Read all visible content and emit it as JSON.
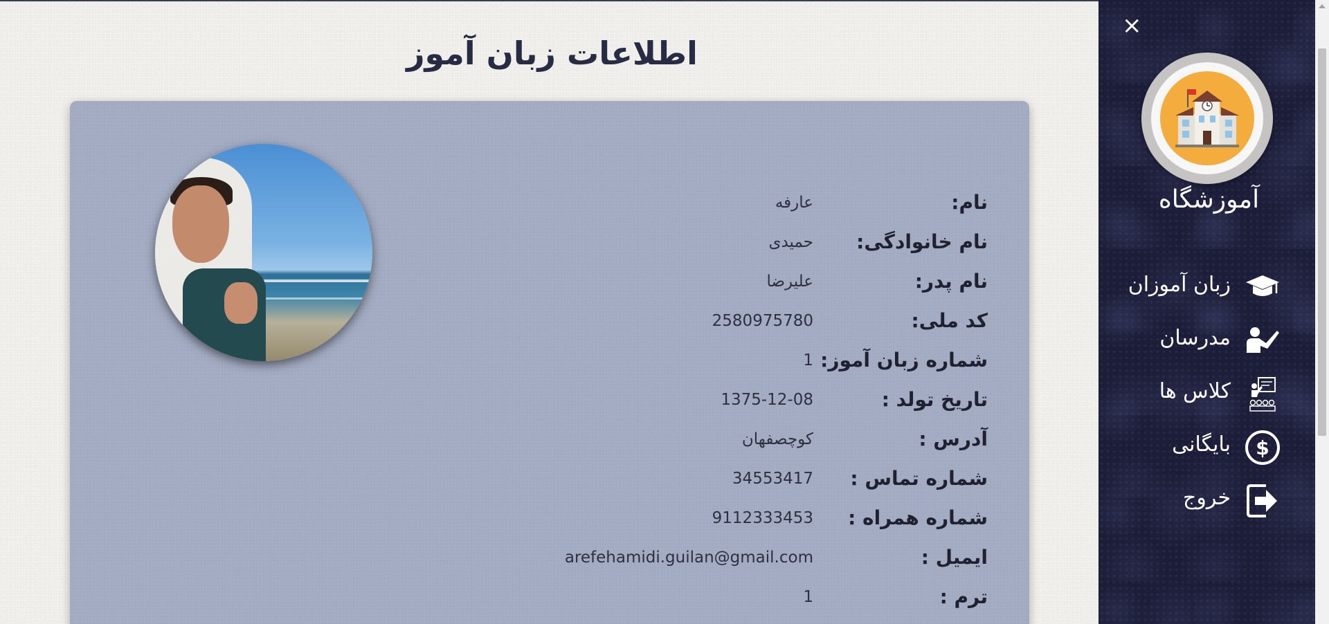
{
  "page": {
    "title": "اطلاعات زبان آموز"
  },
  "student": {
    "fields": [
      {
        "label": "نام:",
        "value": "عارفه"
      },
      {
        "label": "نام خانوادگی:",
        "value": "حمیدی"
      },
      {
        "label": "نام پدر:",
        "value": "علیرضا"
      },
      {
        "label": "کد ملی:",
        "value": "2580975780"
      },
      {
        "label": "شماره زبان آموز:",
        "value": "1"
      },
      {
        "label": "تاریخ تولد :",
        "value": "1375-12-08"
      },
      {
        "label": "آدرس :",
        "value": "کوچصفهان"
      },
      {
        "label": "شماره تماس :",
        "value": "34553417"
      },
      {
        "label": "شماره همراه :",
        "value": "9112333453"
      },
      {
        "label": "ایمیل :",
        "value": "arefehamidi.guilan@gmail.com"
      },
      {
        "label": "ترم :",
        "value": "1"
      }
    ]
  },
  "sidebar": {
    "close_icon": "×",
    "brand": "آموزشگاه",
    "items": [
      {
        "label": "زبان آموزان",
        "icon": "graduation-cap-icon"
      },
      {
        "label": "مدرسان",
        "icon": "teacher-icon"
      },
      {
        "label": "کلاس ها",
        "icon": "classroom-icon"
      },
      {
        "label": "بایگانی",
        "icon": "dollar-circle-icon"
      },
      {
        "label": "خروج",
        "icon": "sign-out-icon"
      }
    ]
  },
  "colors": {
    "sidebar_bg": "#1c1d38",
    "card_bg": "#a4adc4",
    "logo_orange": "#f4ad3d"
  }
}
